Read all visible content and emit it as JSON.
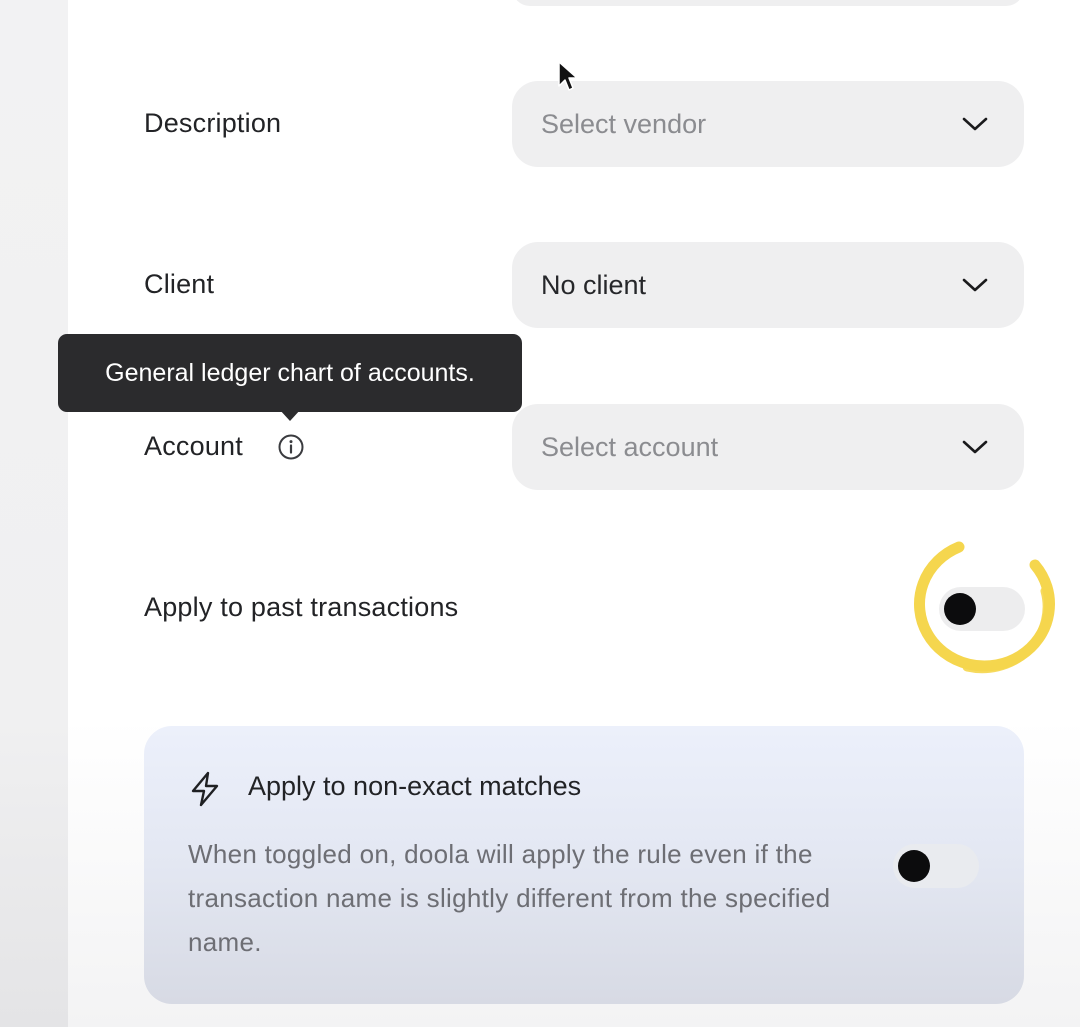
{
  "form": {
    "description": {
      "label": "Description",
      "select_placeholder": "Select vendor"
    },
    "client": {
      "label": "Client",
      "select_value": "No client"
    },
    "account": {
      "label": "Account",
      "select_placeholder": "Select account",
      "tooltip": "General ledger chart of accounts."
    },
    "past_transactions": {
      "label": "Apply to past transactions",
      "toggle_on": false
    }
  },
  "non_exact_card": {
    "title": "Apply to non-exact matches",
    "description": "When toggled on, doola will apply the rule even if the transaction name is slightly different from the specified name.",
    "toggle_on": false,
    "icon": "lightning-bolt-icon"
  },
  "icons": {
    "chevron": "chevron-down-icon",
    "info": "info-icon"
  },
  "colors": {
    "highlight_ring": "#f5d64e",
    "field_background": "#efeff0",
    "tooltip_background": "#2b2b2d",
    "toggle_knob": "#0c0c0d"
  }
}
